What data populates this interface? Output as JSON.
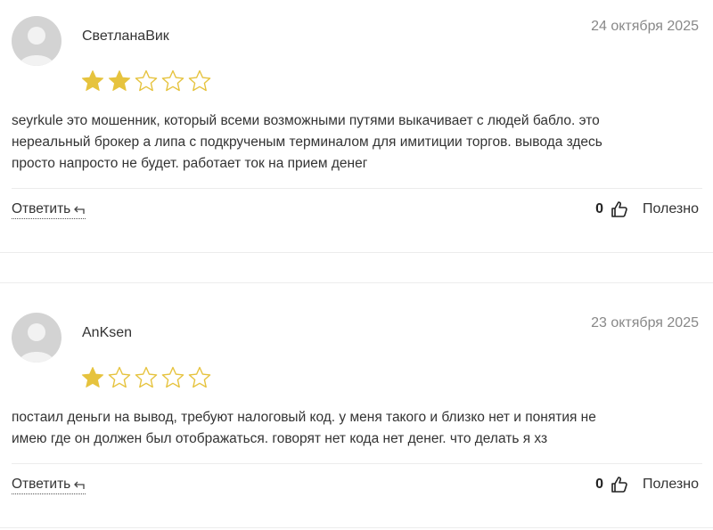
{
  "reviews": [
    {
      "author": "СветланаВик",
      "date": "24 октября 2025",
      "rating": 2,
      "max_rating": 5,
      "text_lines": [
        "seyrkule это мошенник, который всеми возможными путями выкачивает с людей бабло. это",
        "нереальный брокер а липа с подкрученым терминалом для имитиции торгов. вывода здесь",
        "просто напросто не будет. работает ток на прием денег"
      ],
      "reply_label": "Ответить",
      "useful_count": "0",
      "useful_label": "Полезно"
    },
    {
      "author": "AnKsen",
      "date": "23 октября 2025",
      "rating": 1,
      "max_rating": 5,
      "text_lines": [
        "постаил деньги на вывод, требуют налоговый код. у меня такого и близко нет и понятия не",
        "имею где он должен был отображаться. говорят нет кода нет денег. что делать я хз"
      ],
      "reply_label": "Ответить",
      "useful_count": "0",
      "useful_label": "Полезно"
    }
  ],
  "colors": {
    "star_filled": "#e6c33e",
    "star_empty_stroke": "#e6c33e",
    "avatar_bg": "#d3d3d3",
    "avatar_fg": "#f2f2f2"
  }
}
